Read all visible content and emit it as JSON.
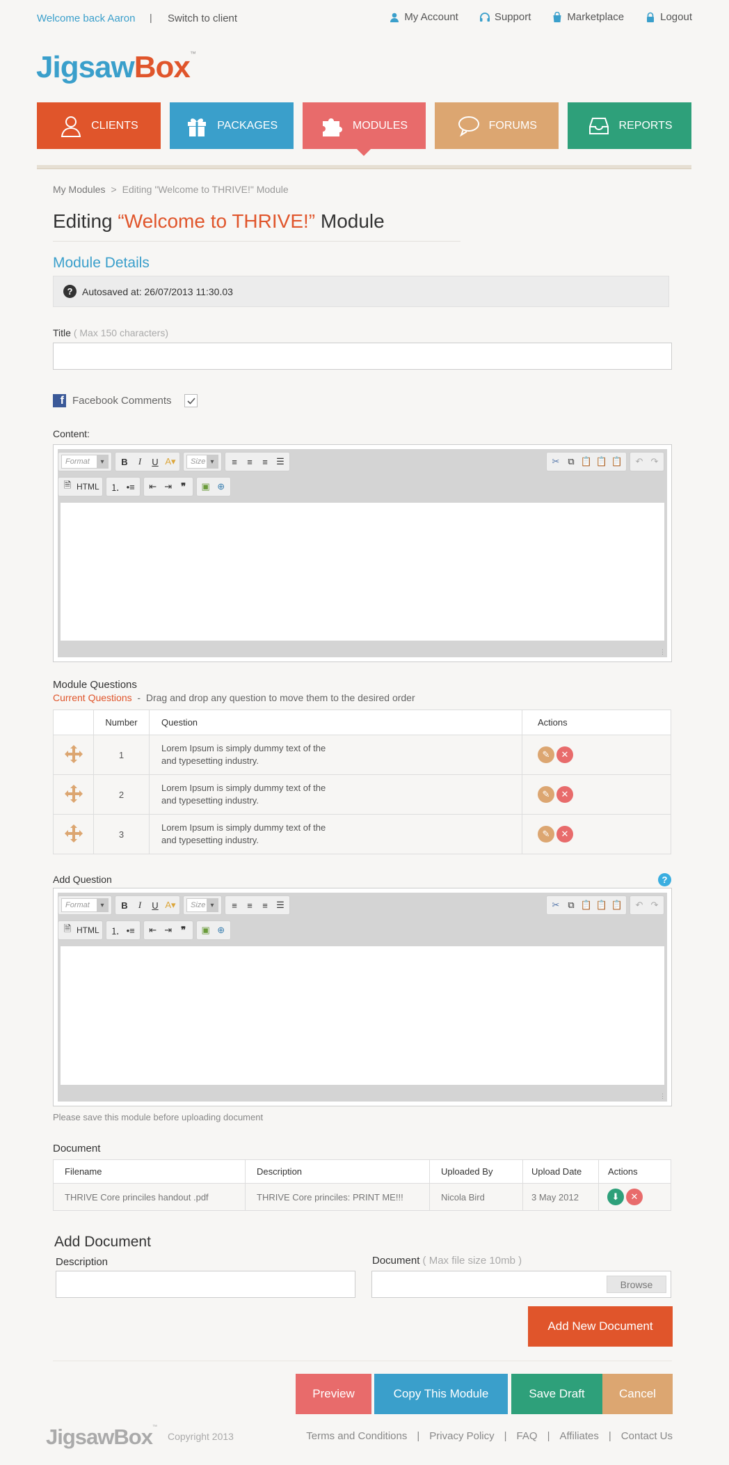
{
  "topbar": {
    "welcome": "Welcome back Aaron",
    "separator": "|",
    "switch_client": "Switch to client",
    "links": [
      {
        "label": "My Account",
        "icon": "user-icon"
      },
      {
        "label": "Support",
        "icon": "headset-icon"
      },
      {
        "label": "Marketplace",
        "icon": "shopping-bag-icon"
      },
      {
        "label": "Logout",
        "icon": "lock-icon"
      }
    ]
  },
  "logo": {
    "part1": "Jigsaw",
    "part2": "Box",
    "tm": "™"
  },
  "nav": [
    {
      "label": "CLIENTS",
      "icon": "person-icon",
      "color": "#e0552b"
    },
    {
      "label": "PACKAGES",
      "icon": "gift-icon",
      "color": "#3a9fcb"
    },
    {
      "label": "MODULES",
      "icon": "puzzle-icon",
      "color": "#e86b6b",
      "active": true
    },
    {
      "label": "FORUMS",
      "icon": "speech-bubble-icon",
      "color": "#dca671"
    },
    {
      "label": "REPORTS",
      "icon": "inbox-tray-icon",
      "color": "#2ea07a"
    }
  ],
  "breadcrumb": {
    "root": "My Modules",
    "sep": ">",
    "current": "Editing \"Welcome to THRIVE!\" Module"
  },
  "page_title": {
    "prefix": "Editing ",
    "highlight": "“Welcome to THRIVE!”",
    "suffix": " Module"
  },
  "module_details": {
    "heading": "Module Details",
    "autosave_icon": "?",
    "autosave": "Autosaved at: 26/07/2013  11:30.03",
    "title_label": "Title",
    "title_hint": "( Max 150 characters)",
    "title_value": "",
    "facebook_icon": "f",
    "facebook_label": "Facebook Comments",
    "facebook_checked": true,
    "content_label": "Content:"
  },
  "editor_toolbar": {
    "format": "Format",
    "size": "Size",
    "html": "HTML"
  },
  "questions": {
    "heading": "Module Questions",
    "current_label": "Current Questions",
    "dash": "-",
    "instruction": "Drag and drop any question to move them to the desired order",
    "columns": [
      "",
      "Number",
      "Question",
      "Actions"
    ],
    "rows": [
      {
        "number": "1",
        "line1": "Lorem Ipsum is simply dummy text of the",
        "line2": "and typesetting industry."
      },
      {
        "number": "2",
        "line1": "Lorem Ipsum is simply dummy text of the",
        "line2": "and typesetting industry."
      },
      {
        "number": "3",
        "line1": "Lorem Ipsum is simply dummy text of the",
        "line2": "and typesetting industry."
      }
    ],
    "add_heading": "Add Question",
    "help_icon": "?"
  },
  "document": {
    "note": "Please save this module before uploading document",
    "heading": "Document",
    "columns": [
      "Filename",
      "Description",
      "Uploaded By",
      "Upload Date",
      "Actions"
    ],
    "rows": [
      {
        "filename": "THRIVE Core princiles handout .pdf",
        "description": "THRIVE Core princiles: PRINT ME!!!",
        "uploaded_by": "Nicola Bird",
        "date": "3 May 2012"
      }
    ]
  },
  "add_document": {
    "heading": "Add Document",
    "description_label": "Description",
    "description_value": "",
    "document_label": "Document",
    "document_hint": "( Max file size 10mb )",
    "browse": "Browse",
    "add_button": "Add New Document"
  },
  "actions": {
    "preview": "Preview",
    "copy": "Copy This Module",
    "save_draft": "Save Draft",
    "cancel": "Cancel"
  },
  "footer": {
    "logo": "JigsawBox",
    "tm": "™",
    "copyright": "Copyright 2013",
    "links": [
      "Terms and Conditions",
      "Privacy Policy",
      "FAQ",
      "Affiliates",
      "Contact Us"
    ],
    "sep": "|"
  }
}
